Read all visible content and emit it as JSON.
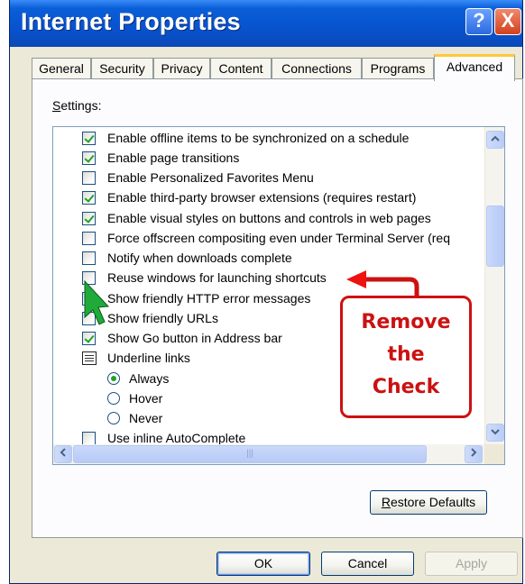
{
  "window": {
    "title": "Internet Properties",
    "help_glyph": "?",
    "close_glyph": "X"
  },
  "tabs": [
    {
      "label": "General"
    },
    {
      "label": "Security"
    },
    {
      "label": "Privacy"
    },
    {
      "label": "Content"
    },
    {
      "label": "Connections"
    },
    {
      "label": "Programs"
    },
    {
      "label": "Advanced",
      "active": true
    }
  ],
  "settings": {
    "label_accel": "S",
    "label_rest": "ettings:",
    "items": [
      {
        "type": "checkbox",
        "checked": true,
        "label": "Enable offline items to be synchronized on a schedule"
      },
      {
        "type": "checkbox",
        "checked": true,
        "label": "Enable page transitions"
      },
      {
        "type": "checkbox",
        "checked": false,
        "label": "Enable Personalized Favorites Menu"
      },
      {
        "type": "checkbox",
        "checked": true,
        "label": "Enable third-party browser extensions (requires restart)"
      },
      {
        "type": "checkbox",
        "checked": true,
        "label": "Enable visual styles on buttons and controls in web pages"
      },
      {
        "type": "checkbox",
        "checked": false,
        "label": "Force offscreen compositing even under Terminal Server (req"
      },
      {
        "type": "checkbox",
        "checked": false,
        "label": "Notify when downloads complete"
      },
      {
        "type": "checkbox",
        "checked": false,
        "label": "Reuse windows for launching shortcuts"
      },
      {
        "type": "checkbox",
        "checked": true,
        "label": "Show friendly HTTP error messages"
      },
      {
        "type": "checkbox",
        "checked": false,
        "label": "Show friendly URLs"
      },
      {
        "type": "checkbox",
        "checked": true,
        "label": "Show Go button in Address bar"
      },
      {
        "type": "group",
        "label": "Underline links"
      },
      {
        "type": "radio",
        "selected": true,
        "label": "Always"
      },
      {
        "type": "radio",
        "selected": false,
        "label": "Hover"
      },
      {
        "type": "radio",
        "selected": false,
        "label": "Never"
      },
      {
        "type": "checkbox",
        "checked": false,
        "label": "Use inline AutoComplete"
      }
    ]
  },
  "scrollbar": {
    "up": "^",
    "down": "v",
    "left": "<",
    "right": ">",
    "grip": "|||"
  },
  "buttons": {
    "restore_accel": "R",
    "restore_rest": "estore Defaults",
    "ok": "OK",
    "cancel": "Cancel",
    "apply": "Apply"
  },
  "annotation": {
    "lines": [
      "Remove",
      "the",
      "Check"
    ],
    "color": "#cc1111"
  }
}
